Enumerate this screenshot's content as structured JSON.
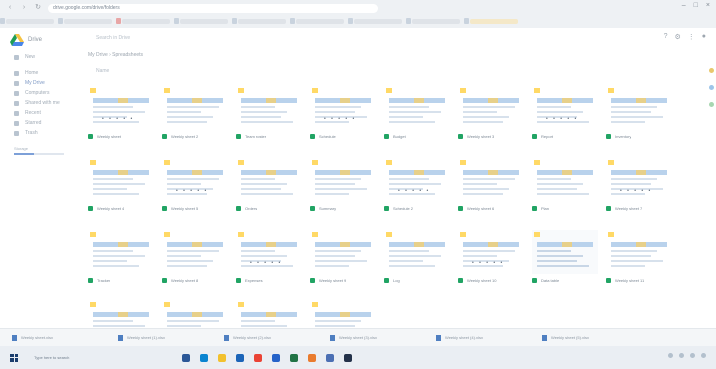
{
  "browser": {
    "url": "drive.google.com/drive/folders",
    "bookmarks": [
      "",
      "",
      "",
      "",
      "",
      "",
      "",
      "",
      ""
    ]
  },
  "app": {
    "title": "Drive",
    "search_placeholder": "Search in Drive",
    "breadcrumb": "My Drive  ›  Spreadsheets",
    "sort_label": "Name",
    "sidebar": [
      {
        "label": "New"
      },
      {
        "label": "Home"
      },
      {
        "label": "My Drive"
      },
      {
        "label": "Computers"
      },
      {
        "label": "Shared with me"
      },
      {
        "label": "Recent"
      },
      {
        "label": "Starred"
      },
      {
        "label": "Trash"
      }
    ],
    "storage_text": "Storage",
    "files": [
      {
        "name": "Weekly sheet"
      },
      {
        "name": "Weekly sheet 2"
      },
      {
        "name": "Team roster"
      },
      {
        "name": "Schedule"
      },
      {
        "name": "Budget"
      },
      {
        "name": "Weekly sheet 3"
      },
      {
        "name": "Report"
      },
      {
        "name": "Inventory"
      },
      {
        "name": "Weekly sheet 4"
      },
      {
        "name": "Weekly sheet 5"
      },
      {
        "name": "Orders"
      },
      {
        "name": "Summary"
      },
      {
        "name": "Schedule 2"
      },
      {
        "name": "Weekly sheet 6"
      },
      {
        "name": "Plan"
      },
      {
        "name": "Weekly sheet 7"
      },
      {
        "name": "Tracker"
      },
      {
        "name": "Weekly sheet 8"
      },
      {
        "name": "Expenses"
      },
      {
        "name": "Weekly sheet 9"
      },
      {
        "name": "Log"
      },
      {
        "name": "Weekly sheet 10"
      },
      {
        "name": "Data table"
      },
      {
        "name": "Weekly sheet 11"
      },
      {
        "name": "Weekly sheet 12"
      },
      {
        "name": "Weekly sheet 13"
      },
      {
        "name": "Weekly sheet 14"
      },
      {
        "name": "Weekly sheet 15"
      }
    ]
  },
  "downloads": [
    "Weekly sheet.xlsx",
    "Weekly sheet (1).xlsx",
    "Weekly sheet (2).xlsx",
    "Weekly sheet (3).xlsx",
    "Weekly sheet (4).xlsx",
    "Weekly sheet (5).xlsx"
  ],
  "taskbar": {
    "search_placeholder": "Type here to search"
  },
  "colors": {
    "sheet_green": "#21a464",
    "header_blue": "#b9d2ec",
    "flag_yellow": "#ffd966"
  }
}
